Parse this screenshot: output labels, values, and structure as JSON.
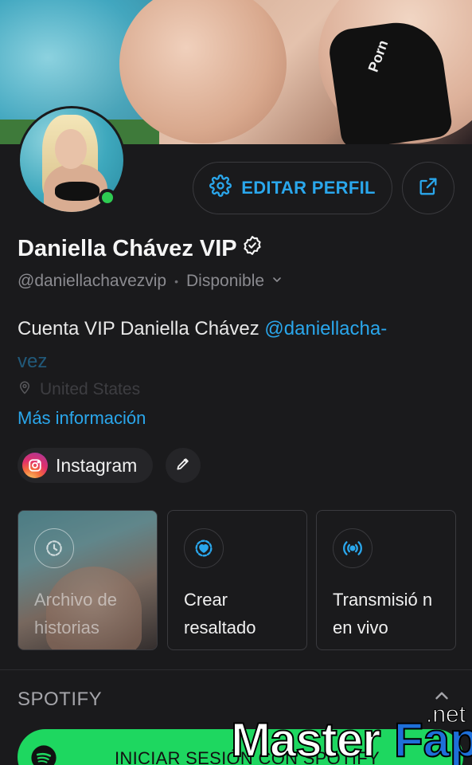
{
  "profile": {
    "edit_label": "EDITAR PERFIL",
    "name": "Daniella Chávez VIP",
    "handle": "@daniellachavezvip",
    "separator": "•",
    "status": "Disponible",
    "bio_text": "Cuenta VIP Daniella Chávez ",
    "bio_mention": "@daniellacha-",
    "bio_mention_cont": "vez",
    "location": "United States",
    "more_info": "Más información"
  },
  "links": {
    "instagram_label": "Instagram"
  },
  "highlights": [
    {
      "label": "Archivo de historias"
    },
    {
      "label": "Crear resaltado"
    },
    {
      "label": "Transmisió n en vivo"
    }
  ],
  "spotify": {
    "section_title": "SPOTIFY",
    "login_label": "INICIAR SESIÓN CON SPOTIFY"
  },
  "watermark": {
    "part1": "Master",
    "part2": "Fap",
    "part3": ".net"
  },
  "colors": {
    "accent": "#2aa7ec",
    "online": "#2ecc52",
    "spotify": "#1ed760",
    "background": "#1a1a1c"
  }
}
